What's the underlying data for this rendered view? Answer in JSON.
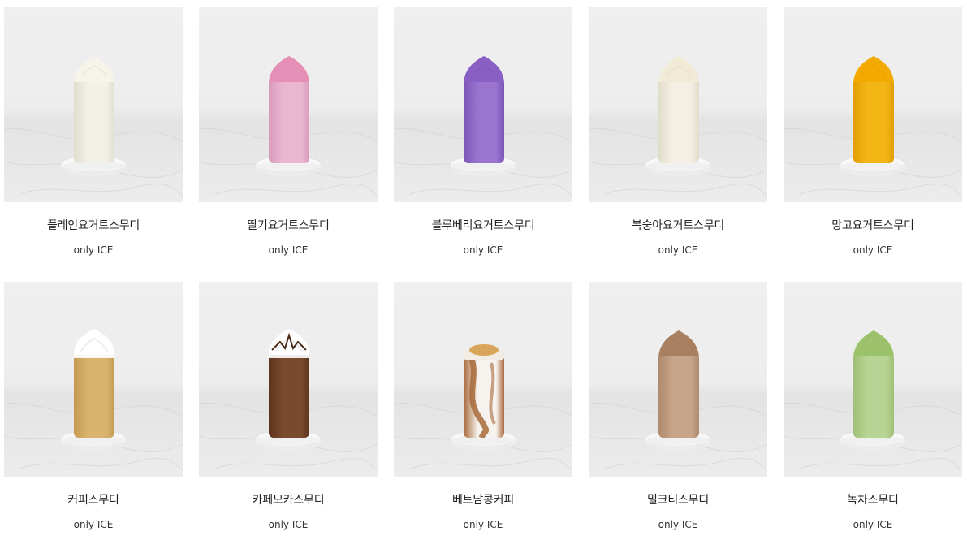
{
  "products": [
    {
      "name": "플레인요거트스무디",
      "tag": "only ICE",
      "body": "#f3f0e8",
      "body_dark": "#e2ddd0",
      "top": "#f6f3ea",
      "topping": "scoop"
    },
    {
      "name": "딸기요거트스무디",
      "tag": "only ICE",
      "body": "#eab7d0",
      "body_dark": "#d99bbb",
      "top": "#e68fb6",
      "topping": "scoop"
    },
    {
      "name": "블루베리요거트스무디",
      "tag": "only ICE",
      "body": "#9a74cf",
      "body_dark": "#7d55b8",
      "top": "#8a5fc4",
      "topping": "scoop"
    },
    {
      "name": "복숭아요거트스무디",
      "tag": "only ICE",
      "body": "#f3efe2",
      "body_dark": "#e1dccb",
      "top": "#f1ead6",
      "topping": "scoop"
    },
    {
      "name": "망고요거트스무디",
      "tag": "only ICE",
      "body": "#f4b615",
      "body_dark": "#e29e05",
      "top": "#f2a900",
      "topping": "scoop"
    },
    {
      "name": "커피스무디",
      "tag": "only ICE",
      "body": "#d9b46e",
      "body_dark": "#c49a50",
      "top": "#ffffff",
      "topping": "cream"
    },
    {
      "name": "카페모카스무디",
      "tag": "only ICE",
      "body": "#7a4a2c",
      "body_dark": "#5c341d",
      "top": "#ffffff",
      "topping": "cream-choco"
    },
    {
      "name": "베트남콩커피",
      "tag": "only ICE",
      "body": "#f6f3ee",
      "body_dark": "#a8683a",
      "top": "#d9a55a",
      "topping": "marble"
    },
    {
      "name": "밀크티스무디",
      "tag": "only ICE",
      "body": "#c7a58a",
      "body_dark": "#b08a6c",
      "top": "#a9805f",
      "topping": "scoop"
    },
    {
      "name": "녹차스무디",
      "tag": "only ICE",
      "body": "#b8d494",
      "body_dark": "#9fc077",
      "top": "#9bc26a",
      "topping": "scoop"
    }
  ]
}
